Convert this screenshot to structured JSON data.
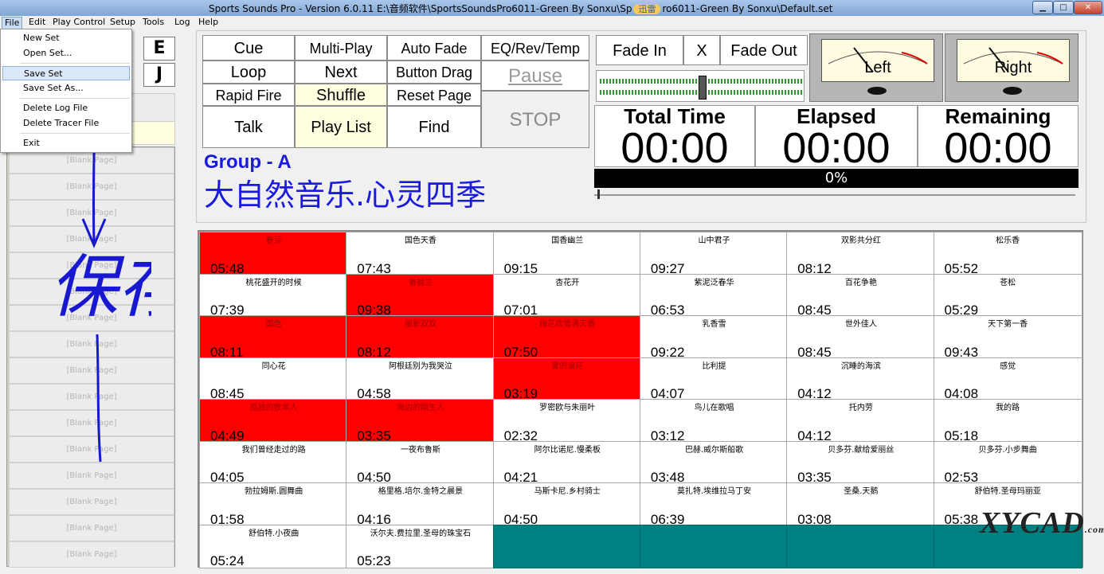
{
  "window": {
    "title": "Sports Sounds Pro - Version 6.0.11     E:\\音频软件\\SportsSoundsPro6011-Green By Sonxu\\Sp",
    "title_tail": "ro6011-Green By Sonxu\\Default.set",
    "overlay_badge": "迅雷",
    "minimize": "▁",
    "maximize": "□",
    "close": "✕"
  },
  "menu": [
    "File",
    "Edit",
    "Play Control",
    "Setup",
    "Tools",
    "Log",
    "Help"
  ],
  "file_menu": {
    "items": [
      "New Set",
      "Open Set...",
      "Save Set",
      "Save Set As...",
      "Delete Log File",
      "Delete Tracer File",
      "Exit"
    ],
    "highlighted": "Save Set"
  },
  "left_panel": {
    "letters": [
      "E",
      "J"
    ],
    "page_label": "[Blank Page]",
    "pages": [
      "[Blank Page]",
      "[Blank Page]",
      "[Blank Page]",
      "[Blank Page]",
      "[Blank Page]",
      "[Blank Page]",
      "[Blank Page]",
      "[Blank Page]",
      "[Blank Page]",
      "[Blank Page]",
      "[Blank Page]",
      "[Blank Page]",
      "[Blank Page]",
      "[Blank Page]",
      "[Blank Page]",
      "[Blank Page]"
    ]
  },
  "controls": {
    "cue": "Cue",
    "multi_play": "Multi-Play",
    "auto_fade": "Auto Fade",
    "eq": "EQ/Rev/Temp",
    "loop": "Loop",
    "next": "Next",
    "button_drag": "Button Drag",
    "pause": "Pause",
    "rapid_fire": "Rapid Fire",
    "shuffle": "Shuffle",
    "reset_page": "Reset Page",
    "talk": "Talk",
    "play_list": "Play List",
    "find": "Find",
    "stop": "STOP",
    "fade_in": "Fade In",
    "x": "X",
    "fade_out": "Fade Out"
  },
  "meters": {
    "left": "Left",
    "right": "Right"
  },
  "timers": {
    "total_label": "Total Time",
    "total_value": "00:00",
    "elapsed_label": "Elapsed",
    "elapsed_value": "00:00",
    "remaining_label": "Remaining",
    "remaining_value": "00:00"
  },
  "progress": {
    "text": "0%",
    "value": 0
  },
  "group": {
    "label": "Group - A",
    "name": "大自然音乐.心灵四季"
  },
  "annotation": {
    "text": "保存"
  },
  "colors": {
    "playing": "#ff0000",
    "empty": "#008080",
    "group_text": "#1a1adb"
  },
  "grid": [
    [
      {
        "t": "春芽",
        "d": "05:48",
        "s": "red"
      },
      {
        "t": "国色天香",
        "d": "07:43"
      },
      {
        "t": "国香幽兰",
        "d": "09:15"
      },
      {
        "t": "山中君子",
        "d": "09:27"
      },
      {
        "t": "双影共分红",
        "d": "08:12"
      },
      {
        "t": "松乐香",
        "d": "05:52"
      }
    ],
    [
      {
        "t": "桃花盛开的时候",
        "d": "07:39"
      },
      {
        "t": "香祖兰",
        "d": "09:38",
        "s": "red"
      },
      {
        "t": "杏花开",
        "d": "07:01"
      },
      {
        "t": "紫泥泛春华",
        "d": "06:53"
      },
      {
        "t": "百花争艳",
        "d": "08:45"
      },
      {
        "t": "苍松",
        "d": "05:29"
      }
    ],
    [
      {
        "t": "国色",
        "d": "08:11",
        "s": "red"
      },
      {
        "t": "丽影双双",
        "d": "08:12",
        "s": "red"
      },
      {
        "t": "梅花吹雪满天香",
        "d": "07:50",
        "s": "red"
      },
      {
        "t": "乳香雪",
        "d": "09:22"
      },
      {
        "t": "世外佳人",
        "d": "08:45"
      },
      {
        "t": "天下第一香",
        "d": "09:43"
      }
    ],
    [
      {
        "t": "同心花",
        "d": "08:45"
      },
      {
        "t": "阿根廷别为我哭泣",
        "d": "04:58"
      },
      {
        "t": "爱的浪花",
        "d": "03:19",
        "s": "red"
      },
      {
        "t": "比利提",
        "d": "04:07"
      },
      {
        "t": "沉睡的海滨",
        "d": "04:12"
      },
      {
        "t": "感觉",
        "d": "04:08"
      }
    ],
    [
      {
        "t": "孤独的牧羊人",
        "d": "04:49",
        "s": "red"
      },
      {
        "t": "海边的陌生人",
        "d": "03:35",
        "s": "red"
      },
      {
        "t": "罗密欧与朱丽叶",
        "d": "02:32"
      },
      {
        "t": "鸟儿在歌唱",
        "d": "03:12"
      },
      {
        "t": "托内劳",
        "d": "04:12"
      },
      {
        "t": "我的路",
        "d": "05:18"
      }
    ],
    [
      {
        "t": "我们曾经走过的路",
        "d": "04:05"
      },
      {
        "t": "一夜布鲁斯",
        "d": "04:50"
      },
      {
        "t": "阿尔比诺尼.慢柔板",
        "d": "04:21"
      },
      {
        "t": "巴赫.威尔斯船歌",
        "d": "03:48"
      },
      {
        "t": "贝多芬.献给爱丽丝",
        "d": "03:35"
      },
      {
        "t": "贝多芬.小步舞曲",
        "d": "02:53"
      }
    ],
    [
      {
        "t": "勃拉姆斯.圆舞曲",
        "d": "01:58"
      },
      {
        "t": "格里格.培尔.金特之晨景",
        "d": "04:16"
      },
      {
        "t": "马斯卡尼.乡村骑士",
        "d": "04:50"
      },
      {
        "t": "莫扎特.埃维拉马丁安",
        "d": "06:39"
      },
      {
        "t": "圣桑.天鹅",
        "d": "03:08"
      },
      {
        "t": "舒伯特.圣母玛丽亚",
        "d": "05:38"
      }
    ],
    [
      {
        "t": "舒伯特.小夜曲",
        "d": "05:24"
      },
      {
        "t": "沃尔夫.费拉里.圣母的珠宝石",
        "d": "05:23"
      },
      {
        "t": "",
        "d": "",
        "s": "teal"
      },
      {
        "t": "",
        "d": "",
        "s": "teal"
      },
      {
        "t": "",
        "d": "",
        "s": "teal"
      },
      {
        "t": "",
        "d": "",
        "s": "teal"
      }
    ]
  ],
  "watermark": {
    "text": "XYCAD",
    "suffix": ".com"
  }
}
